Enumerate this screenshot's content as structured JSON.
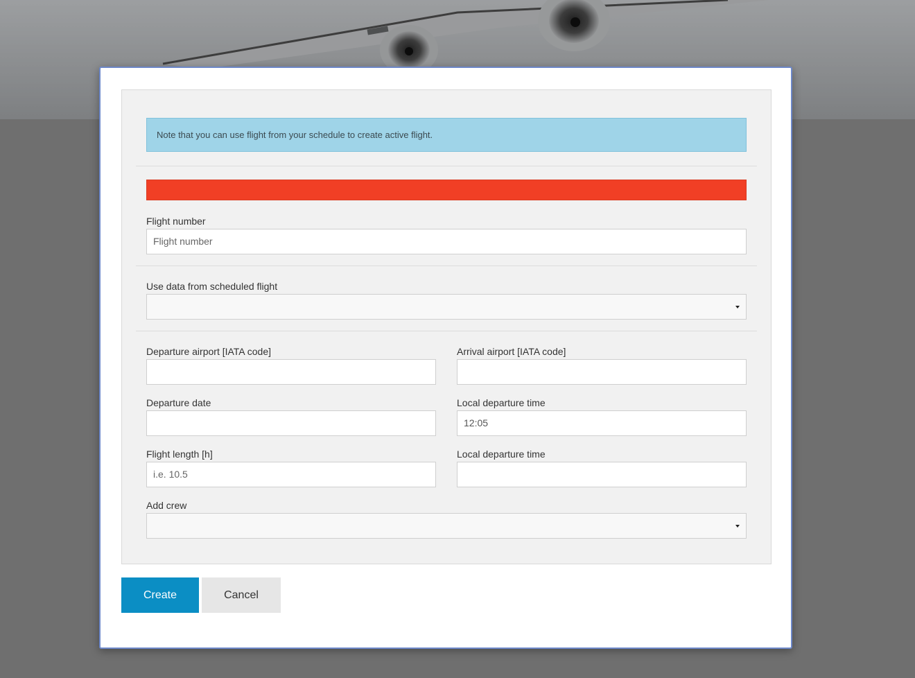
{
  "info_alert": "Note that you can use flight from your schedule to create active flight.",
  "fields": {
    "flight_number": {
      "label": "Flight number",
      "placeholder": "Flight number"
    },
    "scheduled_flight": {
      "label": "Use data from scheduled flight",
      "value": ""
    },
    "departure_airport": {
      "label": "Departure airport [IATA code]",
      "value": ""
    },
    "arrival_airport": {
      "label": "Arrival airport [IATA code]",
      "value": ""
    },
    "departure_date": {
      "label": "Departure date",
      "value": ""
    },
    "local_departure_time": {
      "label": "Local departure time",
      "value": "12:05"
    },
    "flight_length": {
      "label": "Flight length [h]",
      "placeholder": "i.e. 10.5"
    },
    "local_departure_time_2": {
      "label": "Local departure time",
      "value": ""
    },
    "add_crew": {
      "label": "Add crew",
      "value": ""
    }
  },
  "buttons": {
    "create": "Create",
    "cancel": "Cancel"
  },
  "colors": {
    "info": "#9fd4e8",
    "error": "#f13f25",
    "primary": "#0b8ec4"
  }
}
